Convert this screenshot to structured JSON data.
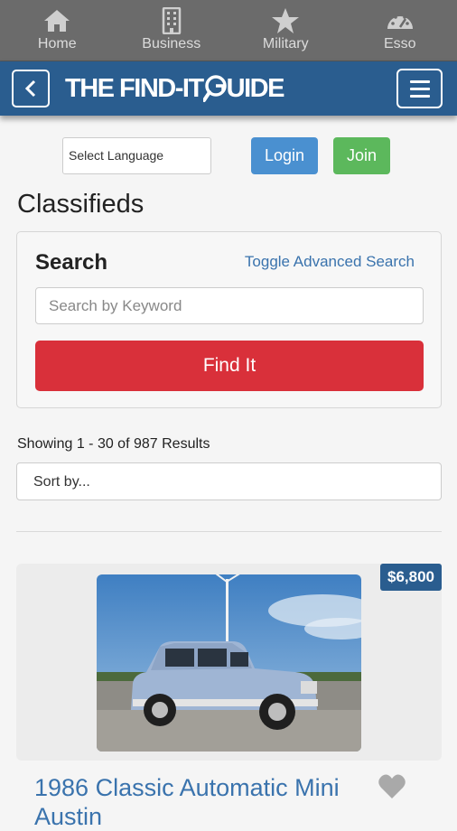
{
  "tabs": [
    {
      "label": "Home",
      "icon": "home-icon"
    },
    {
      "label": "Business",
      "icon": "building-icon"
    },
    {
      "label": "Military",
      "icon": "star-icon"
    },
    {
      "label": "Esso",
      "icon": "gauge-icon"
    }
  ],
  "header": {
    "logo_left": "THE FIND-IT",
    "logo_right": "UIDE",
    "back_icon": "chevron-left-icon",
    "menu_icon": "hamburger-icon"
  },
  "language": {
    "label": "Select Language"
  },
  "auth": {
    "login": "Login",
    "join": "Join"
  },
  "page": {
    "title": "Classifieds"
  },
  "search": {
    "title": "Search",
    "toggle": "Toggle Advanced Search",
    "placeholder": "Search by Keyword",
    "button": "Find It"
  },
  "results": {
    "summary": "Showing 1 - 30 of 987 Results",
    "sort_label": "Sort by..."
  },
  "listing": {
    "price": "$6,800",
    "title": "1986 Classic Automatic Mini Austin",
    "favorite_icon": "heart-icon"
  },
  "colors": {
    "header_blue": "#2a5d8f",
    "find_red": "#d9303a",
    "login_blue": "#4a90d0",
    "join_green": "#5cb85c",
    "link_blue": "#3a73ad"
  }
}
